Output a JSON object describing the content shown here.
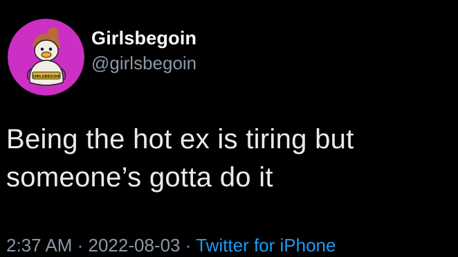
{
  "colors": {
    "background": "#000000",
    "avatar_background": "#cc2fc3",
    "text_primary": "#ffffff",
    "text_secondary": "#8b98a5",
    "link": "#1d9bf0"
  },
  "author": {
    "display_name": "Girlsbegoin",
    "handle": "@girlsbegoin",
    "avatar_icon": "duck-character-avatar",
    "avatar_badge_text": "GIRLSBEGOIN"
  },
  "tweet": {
    "text": "Being the hot ex is tiring but\nsomeone’s gotta do it"
  },
  "meta": {
    "time": "2:37 AM",
    "date": "2022-08-03",
    "separator": " · ",
    "source": "Twitter for iPhone"
  }
}
